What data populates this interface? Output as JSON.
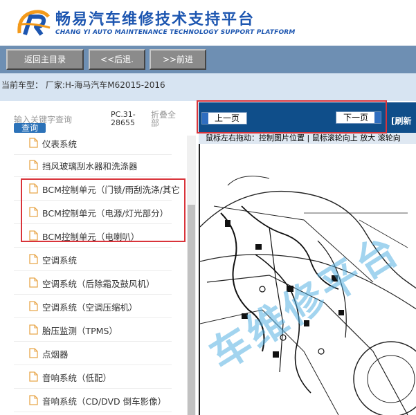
{
  "header": {
    "title": "畅易汽车维修技术支持平台",
    "subtitle": "CHANG YI AUTO MAINTENANCE TECHNOLOGY SUPPORT PLATFORM",
    "brand_color": "#1d56b0"
  },
  "nav": {
    "home_label": "返回主目录",
    "back_label": "<<后退.",
    "forward_label": ">>前进"
  },
  "vehicle": {
    "text": "当前车型： 厂家:H-海马汽车M62015-2016"
  },
  "sidebar": {
    "search_placeholder": "输入关键字查询",
    "search_button": "查询",
    "pc_code": "PC.31-28655",
    "collapse_all": "折叠全部",
    "items": [
      {
        "label": "仪表系统"
      },
      {
        "label": "挡风玻璃刮水器和洗涤器"
      },
      {
        "label": "BCM控制单元（门锁/雨刮洗涤/其它"
      },
      {
        "label": "BCM控制单元（电源/灯光部分）"
      },
      {
        "label": "BCM控制单元（电喇叭）"
      },
      {
        "label": "空调系统"
      },
      {
        "label": "空调系统（后除霜及鼓风机）"
      },
      {
        "label": "空调系统（空调压缩机）"
      },
      {
        "label": "胎压监测（TPMS）"
      },
      {
        "label": "点烟器"
      },
      {
        "label": "音响系统（低配）"
      },
      {
        "label": "音响系统（CD/DVD 倒车影像）"
      }
    ]
  },
  "viewer": {
    "prev_label": "上一页",
    "next_label": "下一页",
    "refresh_label": "[刷新",
    "instruction": "鼠标左右拖动：控制图片位置 | 鼠标滚轮向上 放大  滚轮向",
    "watermark": "车维修平台",
    "bar_color": "#0f4e8a"
  },
  "colors": {
    "highlight_box": "#d9333a",
    "nav_bar": "#6e8fb3",
    "vehicle_bar": "#d7e4f2"
  }
}
